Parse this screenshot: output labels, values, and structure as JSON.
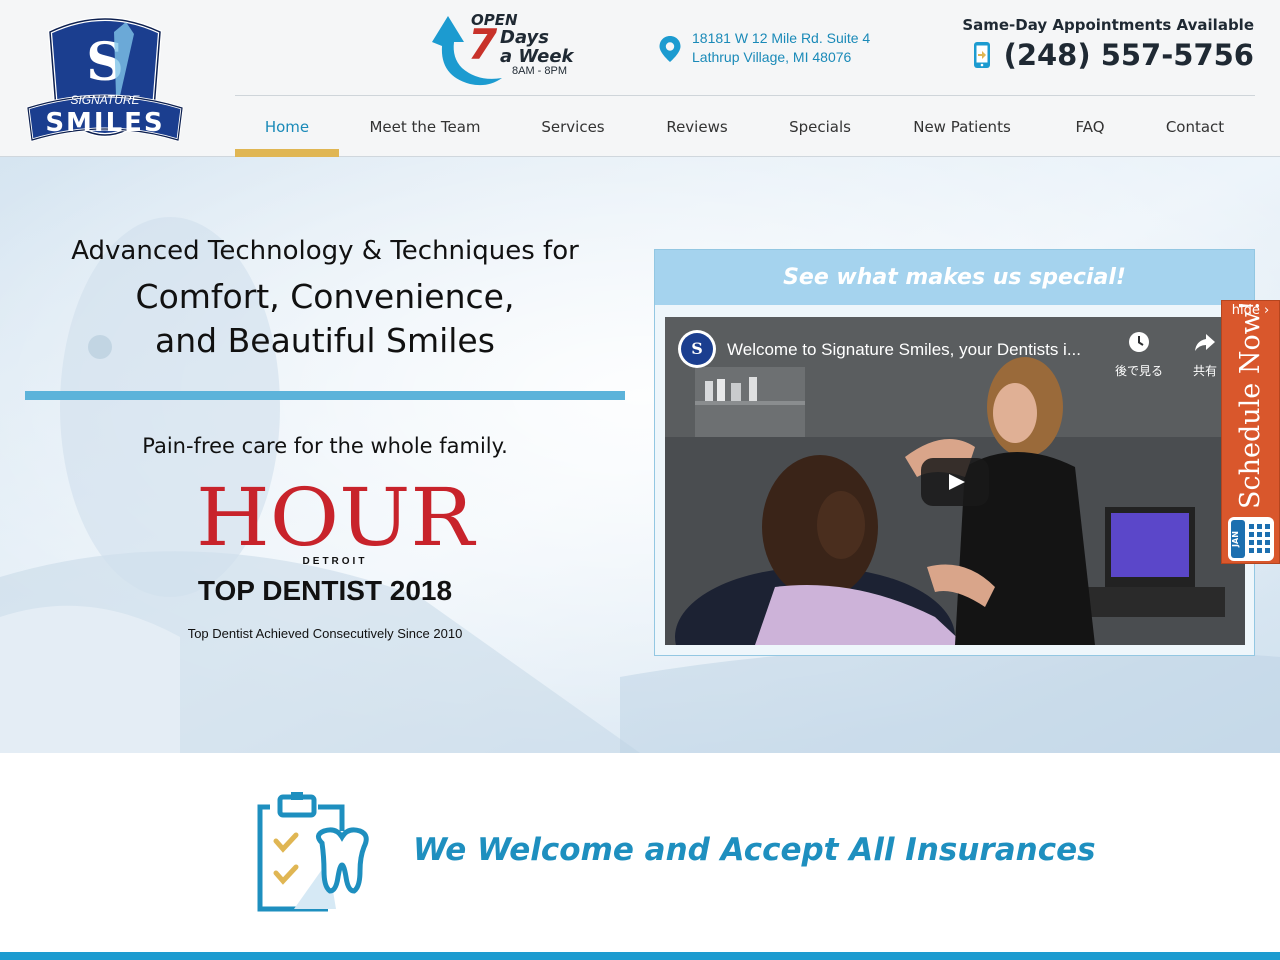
{
  "brand": {
    "logo_top_text": "SIGNATURE",
    "logo_bottom_text": "SMILES",
    "logo_monogram": "S"
  },
  "header": {
    "open": {
      "word": "OPEN",
      "number": "7",
      "days_line_1": "Days",
      "days_line_2": "a Week",
      "hours": "8AM - 8PM"
    },
    "address": {
      "line_1": "18181 W 12 Mile Rd. Suite 4",
      "line_2": "Lathrup Village, MI 48076"
    },
    "same_day": "Same-Day Appointments Available",
    "phone": "(248) 557-5756"
  },
  "nav": {
    "items": [
      {
        "label": "Home",
        "active": true
      },
      {
        "label": "Meet the Team"
      },
      {
        "label": "Services"
      },
      {
        "label": "Reviews"
      },
      {
        "label": "Specials"
      },
      {
        "label": "New Patients"
      },
      {
        "label": "FAQ"
      },
      {
        "label": "Contact"
      }
    ]
  },
  "hero": {
    "headline_1": "Advanced Technology & Techniques for",
    "headline_2a": "Comfort, Convenience,",
    "headline_2b": "and Beautiful Smiles",
    "tagline": "Pain-free care for the whole family.",
    "hour_logo_word": "HOUR",
    "hour_logo_city": "DETROIT",
    "award_title": "TOP DENTIST 2018",
    "award_sub": "Top Dentist Achieved Consecutively Since 2010"
  },
  "video_card": {
    "heading": "See what makes us special!",
    "video_title": "Welcome to Signature Smiles, your Dentists i...",
    "watch_later": "後で見る",
    "share": "共有"
  },
  "schedule_tab": {
    "hide": "hide ›",
    "label": "Schedule Now!",
    "calendar_month": "JAN"
  },
  "insurance": {
    "text": "We Welcome and Accept All Insurances"
  },
  "colors": {
    "accent_blue": "#1a8ab8",
    "nav_active_bar": "#e0b653",
    "hero_bar": "#5cb3da",
    "schedule_orange": "#d9572c",
    "hour_red": "#c8232b"
  },
  "icons": {
    "location": "map-pin-icon",
    "phone": "mobile-phone-icon",
    "open_arrow": "circular-arrow-icon",
    "watch_later": "clock-icon",
    "share": "share-arrow-icon",
    "play": "play-icon",
    "calendar": "calendar-icon",
    "insurance": "clipboard-tooth-icon"
  }
}
